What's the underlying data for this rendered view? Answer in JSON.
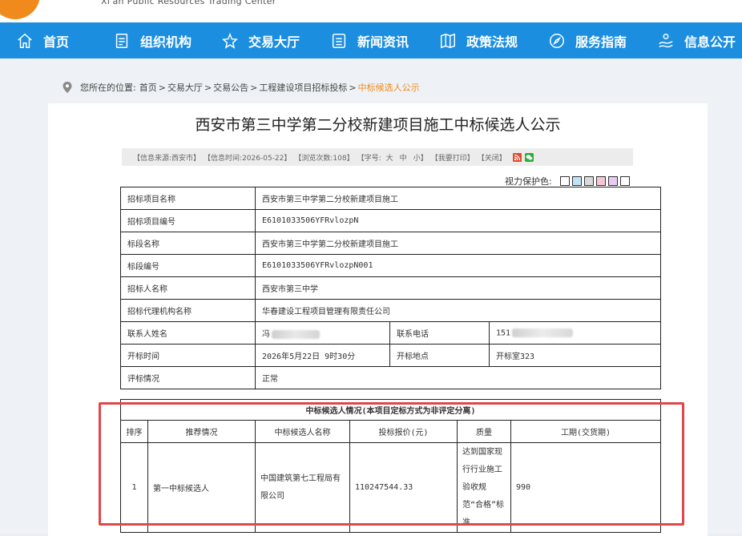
{
  "header": {
    "subtitle": "Xi'an Public Resources Trading Center"
  },
  "nav": [
    {
      "label": "首页",
      "icon": "home-icon"
    },
    {
      "label": "组织机构",
      "icon": "document-icon"
    },
    {
      "label": "交易大厅",
      "icon": "star-icon"
    },
    {
      "label": "新闻资讯",
      "icon": "list-icon"
    },
    {
      "label": "政策法规",
      "icon": "book-icon"
    },
    {
      "label": "服务指南",
      "icon": "compass-icon"
    },
    {
      "label": "信息公开",
      "icon": "hand-icon"
    }
  ],
  "breadcrumb": {
    "prefix": "您所在的位置:",
    "items": [
      "首页",
      "交易大厅",
      "交易公告",
      "工程建设项目招标投标"
    ],
    "current": "中标候选人公示"
  },
  "article": {
    "title": "西安市第三中学第二分校新建项目施工中标候选人公示",
    "info": {
      "source": "【信息来源:西安市】",
      "time": "【信息时间:2026-05-22】",
      "views": "【浏览次数:108】",
      "font_label": "【字号:",
      "font_large": "大",
      "font_medium": "中",
      "font_small": "小】",
      "print": "【我要打印】",
      "close": "【关闭】"
    },
    "eye_care_label": "视力保护色:",
    "eye_colors": [
      "#ffffff",
      "#bfe3f5",
      "#d9d9d9",
      "#f5c6d6",
      "#e6ccf2",
      "#ffffff"
    ]
  },
  "table": {
    "rows": [
      {
        "label": "招标项目名称",
        "value": "西安市第三中学第二分校新建项目施工"
      },
      {
        "label": "招标项目编号",
        "value": "E6101033506YFRvlozpN"
      },
      {
        "label": "标段名称",
        "value": "西安市第三中学第二分校新建项目施工"
      },
      {
        "label": "标段编号",
        "value": "E6101033506YFRvlozpN001"
      },
      {
        "label": "招标人名称",
        "value": "西安市第三中学"
      },
      {
        "label": "招标代理机构名称",
        "value": "华春建设工程项目管理有限责任公司"
      }
    ],
    "contact": {
      "label": "联系人姓名",
      "value": "冯",
      "phone_label": "联系电话",
      "phone": "151"
    },
    "opening": {
      "label": "开标时间",
      "value": "2026年5月22日 9时30分",
      "place_label": "开标地点",
      "place": "开标室323"
    },
    "review": {
      "label": "评标情况",
      "value": "正常"
    }
  },
  "candidates": {
    "section_title": "中标候选人情况(本项目定标方式为非评定分离)",
    "headers": [
      "排序",
      "推荐情况",
      "中标候选人名称",
      "投标报价(元)",
      "质量",
      "工期(交货期)"
    ],
    "rows": [
      {
        "rank": "1",
        "recommend": "第一中标候选人",
        "name": "中国建筑第七工程局有限公司",
        "price": "110247544.33",
        "quality": "达到国家现行行业施工验收规范“合格”标准",
        "period": "990"
      }
    ]
  }
}
